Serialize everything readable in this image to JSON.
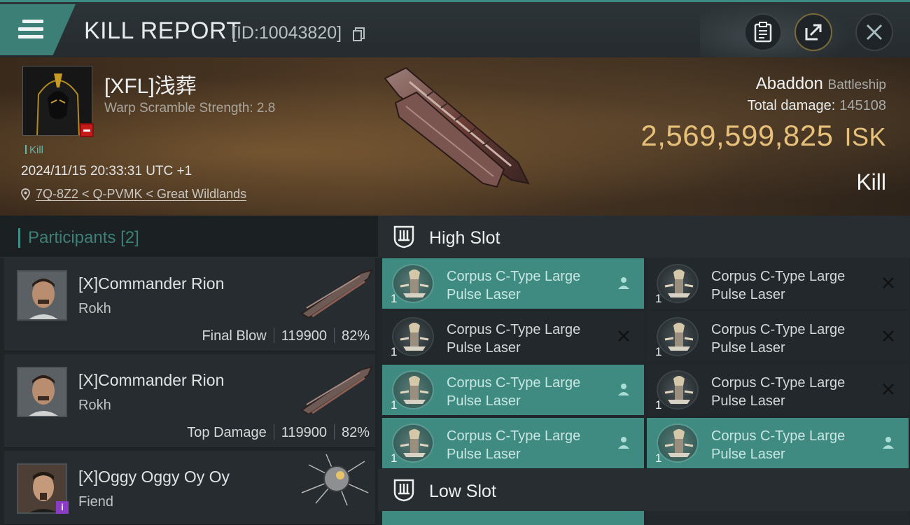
{
  "header": {
    "title": "KILL REPORT",
    "report_id": "[ID:10043820]"
  },
  "victim": {
    "name": "[XFL]浅葬",
    "warp_scramble": "Warp Scramble Strength: 2.8",
    "tag": "Kill",
    "datetime": "2024/11/15 20:33:31 UTC +1",
    "location": "7Q-8Z2 < Q-PVMK < Great Wildlands",
    "ship": "Abaddon",
    "ship_class": "Battleship",
    "total_damage_label": "Total damage:",
    "total_damage": "145108",
    "isk_value": "2,569,599,825",
    "isk_unit": "ISK",
    "result": "Kill"
  },
  "participants": {
    "title": "Participants",
    "count": "[2]",
    "list": [
      {
        "name": "[X]Commander Rion",
        "ship": "Rokh",
        "role": "Final Blow",
        "damage": "119900",
        "percent": "82%"
      },
      {
        "name": "[X]Commander Rion",
        "ship": "Rokh",
        "role": "Top Damage",
        "damage": "119900",
        "percent": "82%"
      },
      {
        "name": "[X]Oggy Oggy Oy Oy",
        "ship": "Fiend",
        "badge": "i"
      }
    ]
  },
  "fitting": {
    "high_slot_title": "High Slot",
    "low_slot_title": "Low Slot",
    "high_slots": [
      {
        "line1": "Corpus C-Type Large",
        "line2": "Pulse Laser",
        "qty": "1",
        "state": "dropped"
      },
      {
        "line1": "Corpus C-Type Large",
        "line2": "Pulse Laser",
        "qty": "1",
        "state": "destroyed"
      },
      {
        "line1": "Corpus C-Type Large",
        "line2": "Pulse Laser",
        "qty": "1",
        "state": "destroyed"
      },
      {
        "line1": "Corpus C-Type Large",
        "line2": "Pulse Laser",
        "qty": "1",
        "state": "destroyed"
      },
      {
        "line1": "Corpus C-Type Large",
        "line2": "Pulse Laser",
        "qty": "1",
        "state": "dropped"
      },
      {
        "line1": "Corpus C-Type Large",
        "line2": "Pulse Laser",
        "qty": "1",
        "state": "destroyed"
      },
      {
        "line1": "Corpus C-Type Large",
        "line2": "Pulse Laser",
        "qty": "1",
        "state": "dropped"
      },
      {
        "line1": "Corpus C-Type Large",
        "line2": "Pulse Laser",
        "qty": "1",
        "state": "dropped"
      }
    ]
  },
  "colors": {
    "accent": "#3f8a81",
    "isk": "#e7c07a",
    "minus_badge": "#c41a1a"
  }
}
